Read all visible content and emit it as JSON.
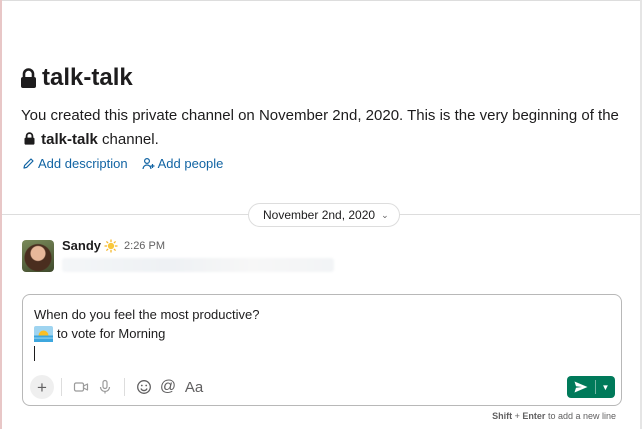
{
  "channel": {
    "name": "talk-talk",
    "intro_before": "You created this private channel on November 2nd, 2020. This is the very beginning of the",
    "intro_after": "channel."
  },
  "actions": {
    "add_description": "Add description",
    "add_people": "Add people"
  },
  "date_divider": {
    "label": "November 2nd, 2020"
  },
  "message": {
    "sender": "Sandy",
    "time": "2:26 PM"
  },
  "composer": {
    "line1": "When do you feel the most productive?",
    "line2": "to vote for Morning",
    "toolbar": {
      "format_label": "Aa",
      "mention_label": "@"
    }
  },
  "hint": {
    "key1": "Shift",
    "plus": "+",
    "key2": "Enter",
    "rest": "to add a new line"
  },
  "colors": {
    "link": "#1264a3",
    "send_button": "#007a5a"
  }
}
